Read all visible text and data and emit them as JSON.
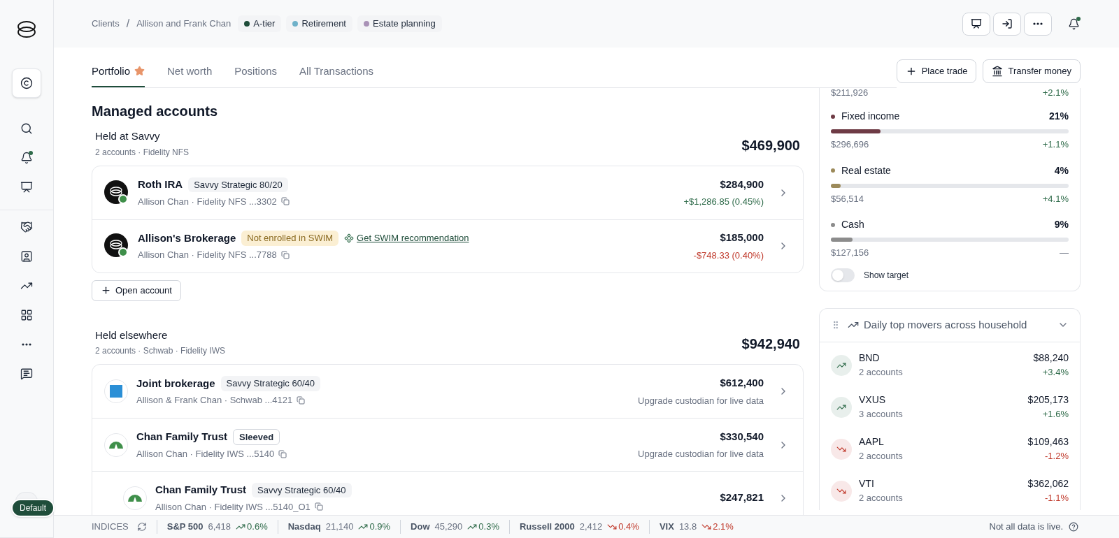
{
  "sidebar": {
    "items": [
      {
        "kind": "client",
        "selected": true,
        "unread": false
      },
      {
        "kind": "search",
        "selected": false,
        "unread": false
      },
      {
        "kind": "bell",
        "selected": false,
        "unread": true
      },
      {
        "kind": "presentation",
        "selected": false,
        "unread": false
      },
      {
        "kind": "handshake",
        "selected": false,
        "unread": false
      },
      {
        "kind": "contact",
        "selected": false,
        "unread": false
      },
      {
        "kind": "trend",
        "selected": false,
        "unread": false
      },
      {
        "kind": "grid",
        "selected": false,
        "unread": false
      },
      {
        "kind": "more",
        "selected": false,
        "unread": false
      },
      {
        "kind": "message",
        "selected": false,
        "unread": false
      }
    ],
    "badge": "Default"
  },
  "header": {
    "breadcrumbs": [
      {
        "label": "Clients"
      },
      {
        "separator": "/",
        "label": "Allison and Frank Chan"
      }
    ],
    "tags": [
      {
        "label": "A-tier",
        "color": "#1f4d3a"
      },
      {
        "label": "Retirement",
        "color": "#6fb1c9"
      },
      {
        "label": "Estate planning",
        "color": "#a992b7"
      }
    ],
    "notifications_unread": true
  },
  "tabs": [
    {
      "label": "Portfolio",
      "selected": true,
      "favorite": true
    },
    {
      "label": "Net worth",
      "selected": false,
      "favorite": false
    },
    {
      "label": "Positions",
      "selected": false,
      "favorite": false
    },
    {
      "label": "All Transactions",
      "selected": false,
      "favorite": false
    }
  ],
  "actions": [
    {
      "label": "Place trade",
      "kind": "plus"
    },
    {
      "label": "Transfer money",
      "kind": "bank"
    }
  ],
  "managed": {
    "title": "Managed accounts",
    "groups": [
      {
        "title": "Held at Savvy",
        "subtitle": "2 accounts · Fidelity NFS",
        "total": "$469,900",
        "accounts": [
          {
            "name": "Roth IRA",
            "kind": "savvy",
            "tag": {
              "label": "Savvy Strategic 80/20",
              "kind": "plain"
            },
            "details": "Allison Chan · Fidelity NFS ...3302",
            "value": "$284,900",
            "change": "+$1,286.85 (0.45%)",
            "gain": true
          },
          {
            "name": "Allison's Brokerage",
            "kind": "savvy",
            "tag": {
              "label": "Not enrolled in SWIM",
              "kind": "warning"
            },
            "link": "Get SWIM recommendation",
            "details": "Allison Chan · Fidelity NFS ...7788",
            "value": "$185,000",
            "change": "-$748.33 (0.40%)",
            "gain": false
          }
        ],
        "open_button": "Open account"
      },
      {
        "title": "Held elsewhere",
        "subtitle": "2 accounts · Schwab · Fidelity IWS",
        "total": "$942,940",
        "accounts": [
          {
            "name": "Joint brokerage",
            "kind": "schwab",
            "tag": {
              "label": "Savvy Strategic 60/40",
              "kind": "plain"
            },
            "details": "Allison & Frank Chan · Schwab ...4121",
            "value": "$612,400",
            "note": "Upgrade custodian for live data"
          },
          {
            "name": "Chan Family Trust",
            "kind": "fidelity",
            "tag": {
              "label": "Sleeved",
              "kind": "outline"
            },
            "details": "Allison Chan · Fidelity IWS ...5140",
            "value": "$330,540",
            "note": "Upgrade custodian for live data",
            "children": [
              {
                "name": "Chan Family Trust",
                "kind": "fidelity",
                "tag": {
                  "label": "Savvy Strategic 60/40",
                  "kind": "plain"
                },
                "details": "Allison Chan · Fidelity IWS ...5140_O1",
                "value": "$247,821"
              }
            ]
          }
        ]
      }
    ]
  },
  "allocation": {
    "partial_row": {
      "value": "$211,926",
      "change": "+2.1%",
      "gain": true
    },
    "rows": [
      {
        "name": "Fixed income",
        "color": "#6e3b45",
        "percent": "21%",
        "level": 0.21,
        "value": "$296,696",
        "change": "+1.1%",
        "gain": true
      },
      {
        "name": "Real estate",
        "color": "#9c8a5a",
        "percent": "4%",
        "level": 0.04,
        "value": "$56,514",
        "change": "+4.1%",
        "gain": true
      },
      {
        "name": "Cash",
        "color": "#8c8c8c",
        "percent": "9%",
        "level": 0.09,
        "value": "$127,156",
        "change": "—",
        "gain": false
      }
    ],
    "toggle": {
      "label": "Show target",
      "on": false
    }
  },
  "movers": {
    "title": "Daily top movers across household",
    "items": [
      {
        "symbol": "BND",
        "accounts": "2 accounts",
        "value": "$88,240",
        "change": "+3.4%",
        "gain": true
      },
      {
        "symbol": "VXUS",
        "accounts": "3 accounts",
        "value": "$205,173",
        "change": "+1.6%",
        "gain": true
      },
      {
        "symbol": "AAPL",
        "accounts": "2 accounts",
        "value": "$109,463",
        "change": "-1.2%",
        "gain": false
      },
      {
        "symbol": "VTI",
        "accounts": "2 accounts",
        "value": "$362,062",
        "change": "-1.1%",
        "gain": false
      }
    ]
  },
  "status_bar": {
    "label": "INDICES",
    "indices": [
      {
        "name": "S&P 500",
        "value": "6,418",
        "change": "0.6%",
        "gain": true
      },
      {
        "name": "Nasdaq",
        "value": "21,140",
        "change": "0.9%",
        "gain": true
      },
      {
        "name": "Dow",
        "value": "45,290",
        "change": "0.3%",
        "gain": true
      },
      {
        "name": "Russell 2000",
        "value": "2,412",
        "change": "0.4%",
        "gain": false
      },
      {
        "name": "VIX",
        "value": "13.8",
        "change": "2.1%",
        "gain": false
      }
    ],
    "note": "Not all data is live."
  }
}
